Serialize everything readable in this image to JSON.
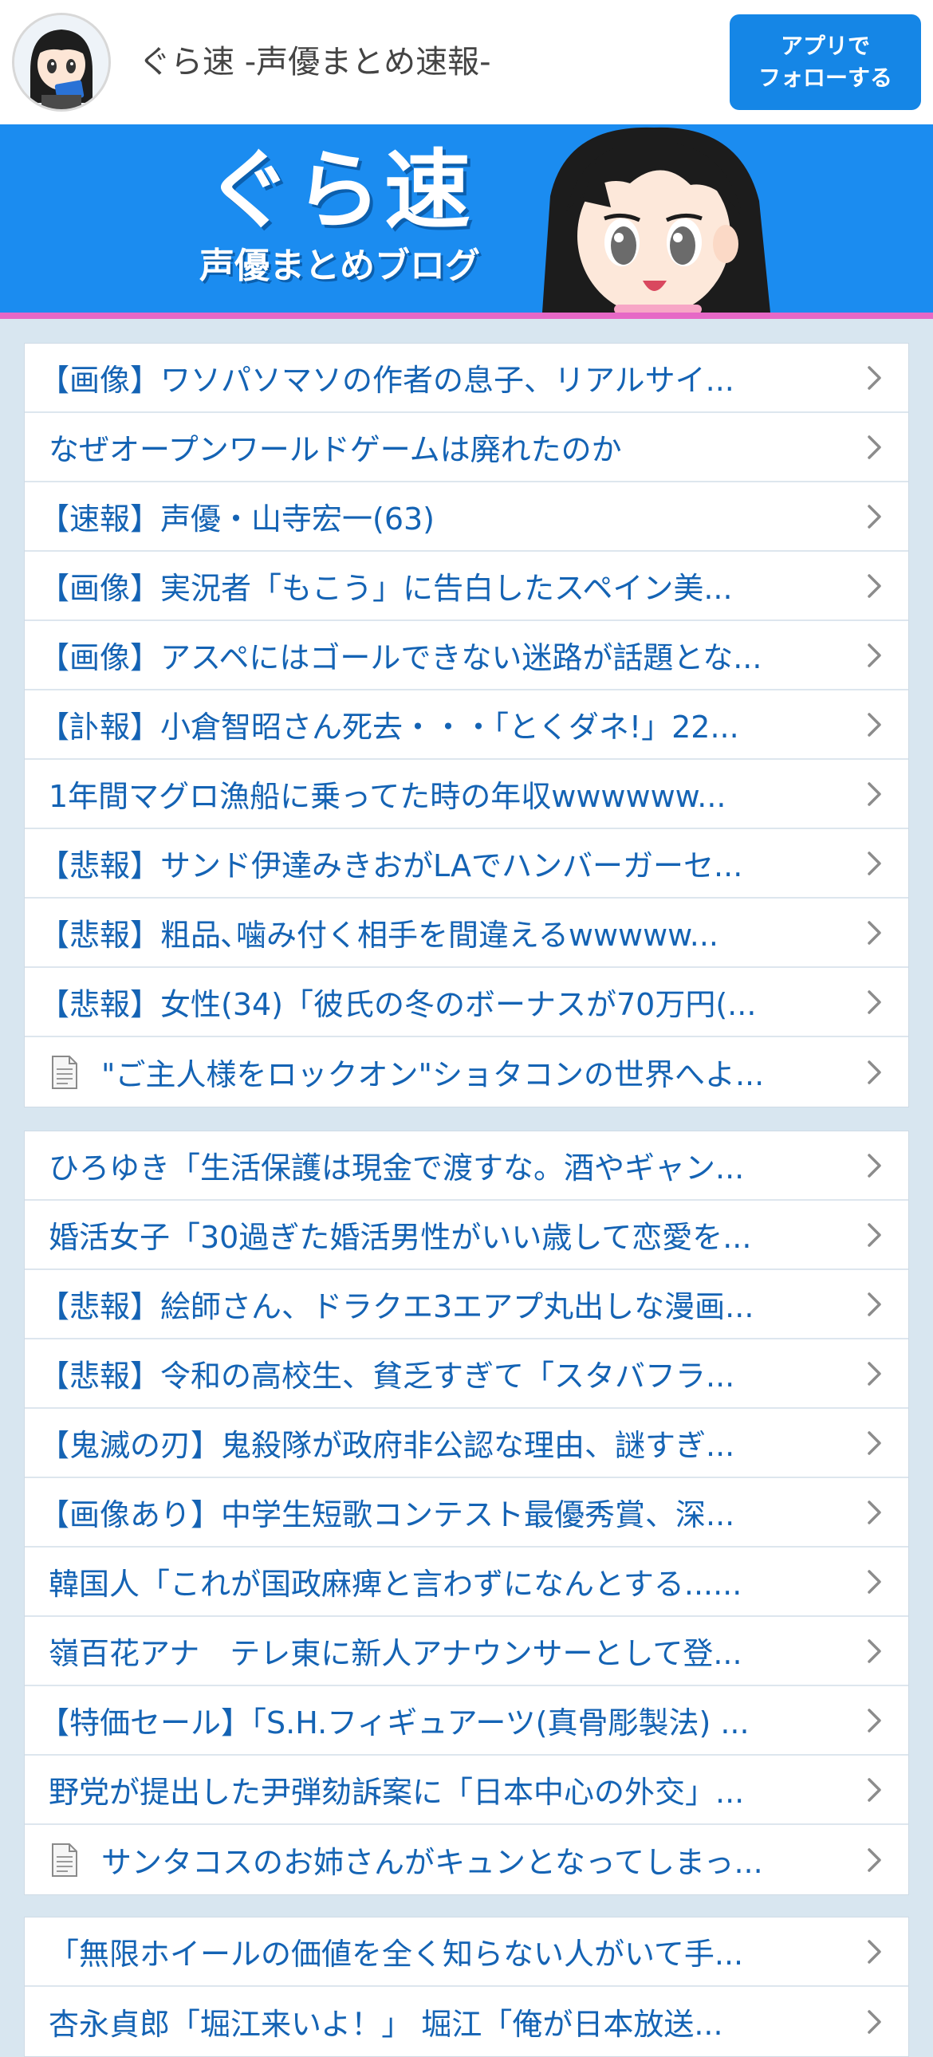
{
  "header": {
    "site_title": "ぐら速 -声優まとめ速報-",
    "follow_button_line1": "アプリで",
    "follow_button_line2": "フォローする"
  },
  "banner": {
    "title": "ぐら速",
    "subtitle": "声優まとめブログ"
  },
  "colors": {
    "accent": "#1586e6",
    "banner_bg": "#1b8cf0",
    "banner_strip": "#e668c6",
    "link_text": "#1463b4",
    "page_bg": "#d8e6f0"
  },
  "icons": {
    "row_chevron": "chevron-right-icon",
    "doc": "document-icon"
  },
  "sections": [
    {
      "items": [
        {
          "title": "【画像】ワソパソマソの作者の息子、リアルサイ...",
          "icon": ""
        },
        {
          "title": "なぜオープンワールドゲームは廃れたのか",
          "icon": ""
        },
        {
          "title": "【速報】声優・山寺宏一(63)",
          "icon": ""
        },
        {
          "title": "【画像】実況者「もこう」に告白したスペイン美...",
          "icon": ""
        },
        {
          "title": "【画像】アスペにはゴールできない迷路が話題とな...",
          "icon": ""
        },
        {
          "title": "【訃報】小倉智昭さん死去・・・「とくダネ!」22...",
          "icon": ""
        },
        {
          "title": "1年間マグロ漁船に乗ってた時の年収wwwwww...",
          "icon": ""
        },
        {
          "title": "【悲報】サンド伊達みきおがLAでハンバーガーセ...",
          "icon": ""
        },
        {
          "title": "【悲報】粗品､噛み付く相手を間違えるwwwww...",
          "icon": ""
        },
        {
          "title": "【悲報】女性(34)「彼氏の冬のボーナスが70万円(...",
          "icon": ""
        },
        {
          "title": "\"ご主人様をロックオン\"ショタコンの世界へよ...",
          "icon": "document-icon"
        }
      ]
    },
    {
      "items": [
        {
          "title": "ひろゆき「生活保護は現金で渡すな。酒やギャン...",
          "icon": ""
        },
        {
          "title": "婚活女子「30過ぎた婚活男性がいい歳して恋愛を...",
          "icon": ""
        },
        {
          "title": "【悲報】絵師さん、ドラクエ3エアプ丸出しな漫画...",
          "icon": ""
        },
        {
          "title": "【悲報】令和の高校生、貧乏すぎて「スタバフラ...",
          "icon": ""
        },
        {
          "title": "【鬼滅の刃】鬼殺隊が政府非公認な理由、謎すぎ...",
          "icon": ""
        },
        {
          "title": "【画像あり】中学生短歌コンテスト最優秀賞、深...",
          "icon": ""
        },
        {
          "title": "韓国人「これが国政麻痺と言わずになんとする......",
          "icon": ""
        },
        {
          "title": "嶺百花アナ　テレ東に新人アナウンサーとして登...",
          "icon": ""
        },
        {
          "title": "【特価セール】「S.H.フィギュアーツ(真骨彫製法) ...",
          "icon": ""
        },
        {
          "title": "野党が提出した尹弾劾訴案に「日本中心の外交」...",
          "icon": ""
        },
        {
          "title": "サンタコスのお姉さんがキュンとなってしまっ...",
          "icon": "document-icon"
        }
      ]
    },
    {
      "items": [
        {
          "title": "「無限ホイールの価値を全く知らない人がいて手...",
          "icon": ""
        },
        {
          "title": "杏永貞郎「堀江来いよ！」 堀江「俺が日本放送...",
          "icon": ""
        }
      ]
    }
  ]
}
